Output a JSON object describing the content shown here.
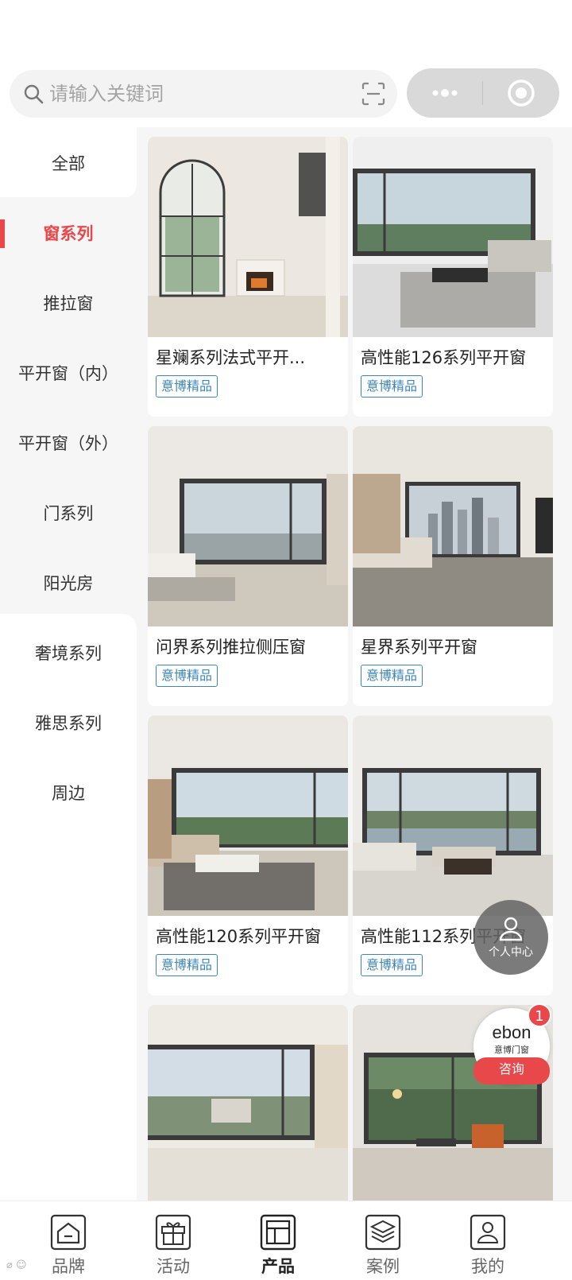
{
  "search": {
    "placeholder": "请输入关键词",
    "left_icon": "search-icon",
    "right_icon": "scan-icon"
  },
  "capsule": {
    "more_icon": "more-dots-icon",
    "close_icon": "target-icon"
  },
  "sidebar": {
    "items": [
      {
        "label": "全部"
      },
      {
        "label": "窗系列",
        "active": true
      },
      {
        "label": "推拉窗"
      },
      {
        "label": "平开窗（内）"
      },
      {
        "label": "平开窗（外）"
      },
      {
        "label": "门系列"
      },
      {
        "label": "阳光房"
      },
      {
        "label": "奢境系列"
      },
      {
        "label": "雅思系列"
      },
      {
        "label": "周边"
      }
    ]
  },
  "products": [
    {
      "title": "星斓系列法式平开...",
      "badge": "意博精品"
    },
    {
      "title": "高性能126系列平开窗",
      "badge": "意博精品"
    },
    {
      "title": "问界系列推拉侧压窗",
      "badge": "意博精品"
    },
    {
      "title": "星界系列平开窗",
      "badge": "意博精品"
    },
    {
      "title": "高性能120系列平开窗",
      "badge": "意博精品"
    },
    {
      "title": "高性能112系列平开窗",
      "badge": "意博精品"
    }
  ],
  "fab": {
    "user_label": "个人中心",
    "user_icon": "user-icon"
  },
  "consult": {
    "brand": "ebon",
    "brand_cn": "意博门窗",
    "button_label": "咨询",
    "count": "1"
  },
  "tabbar": {
    "items": [
      {
        "label": "品牌",
        "icon": "house-icon"
      },
      {
        "label": "活动",
        "icon": "gift-icon"
      },
      {
        "label": "产品",
        "icon": "layout-icon",
        "active": true
      },
      {
        "label": "案例",
        "icon": "layers-icon"
      },
      {
        "label": "我的",
        "icon": "user-icon"
      }
    ]
  },
  "colors": {
    "accent": "#e8484a",
    "badge": "#3f86b8"
  }
}
